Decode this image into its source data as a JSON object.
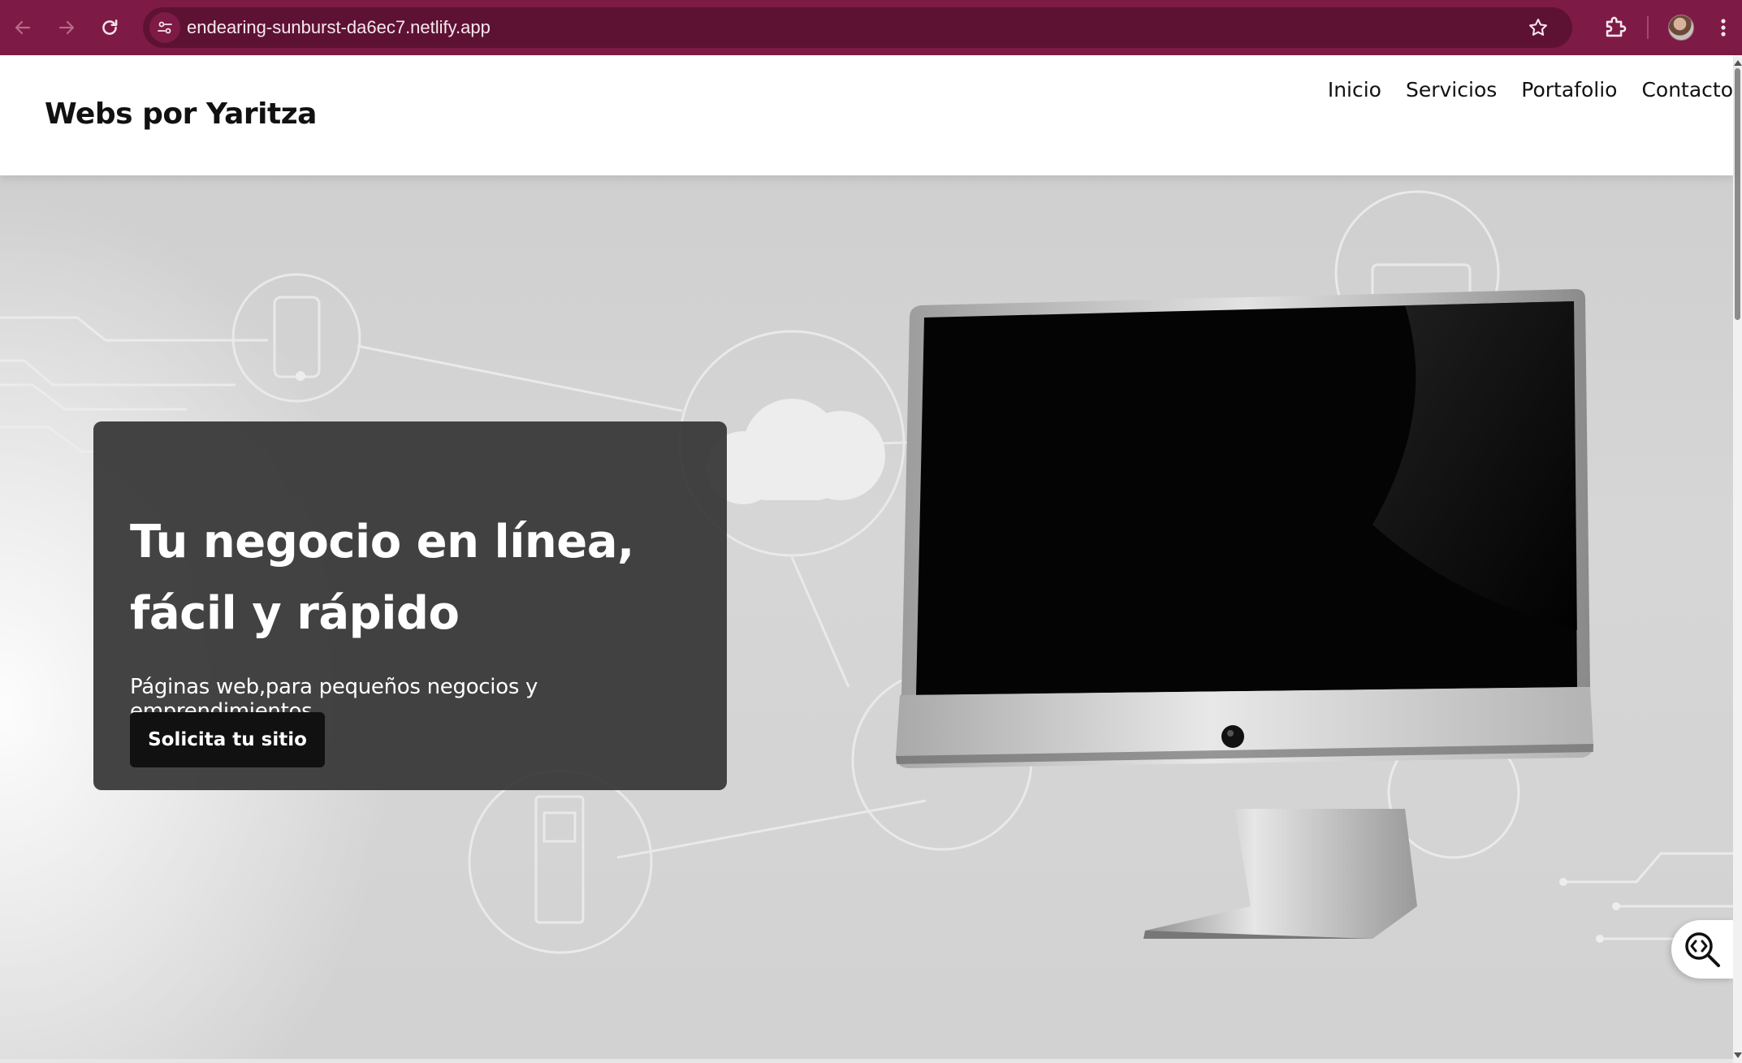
{
  "browser": {
    "url": "endearing-sunburst-da6ec7.netlify.app",
    "back_icon": "arrow-left-icon",
    "forward_icon": "arrow-right-icon",
    "reload_icon": "reload-icon",
    "site_info_icon": "tune-icon",
    "bookmark_icon": "star-icon",
    "extensions_icon": "puzzle-icon",
    "menu_icon": "kebab-icon",
    "accent": "#7e1a46"
  },
  "header": {
    "logo": "Webs por Yaritza",
    "nav": [
      {
        "label": "Inicio"
      },
      {
        "label": "Servicios"
      },
      {
        "label": "Portafolio"
      },
      {
        "label": "Contacto"
      }
    ]
  },
  "hero": {
    "title_line1": "Tu negocio en línea,",
    "title_line2": "fácil y rápido",
    "subtitle": "Páginas web,para pequeños negocios y emprendimientos.",
    "cta_label": "Solicita tu sitio"
  },
  "floating_button": {
    "icon": "code-search-icon"
  }
}
